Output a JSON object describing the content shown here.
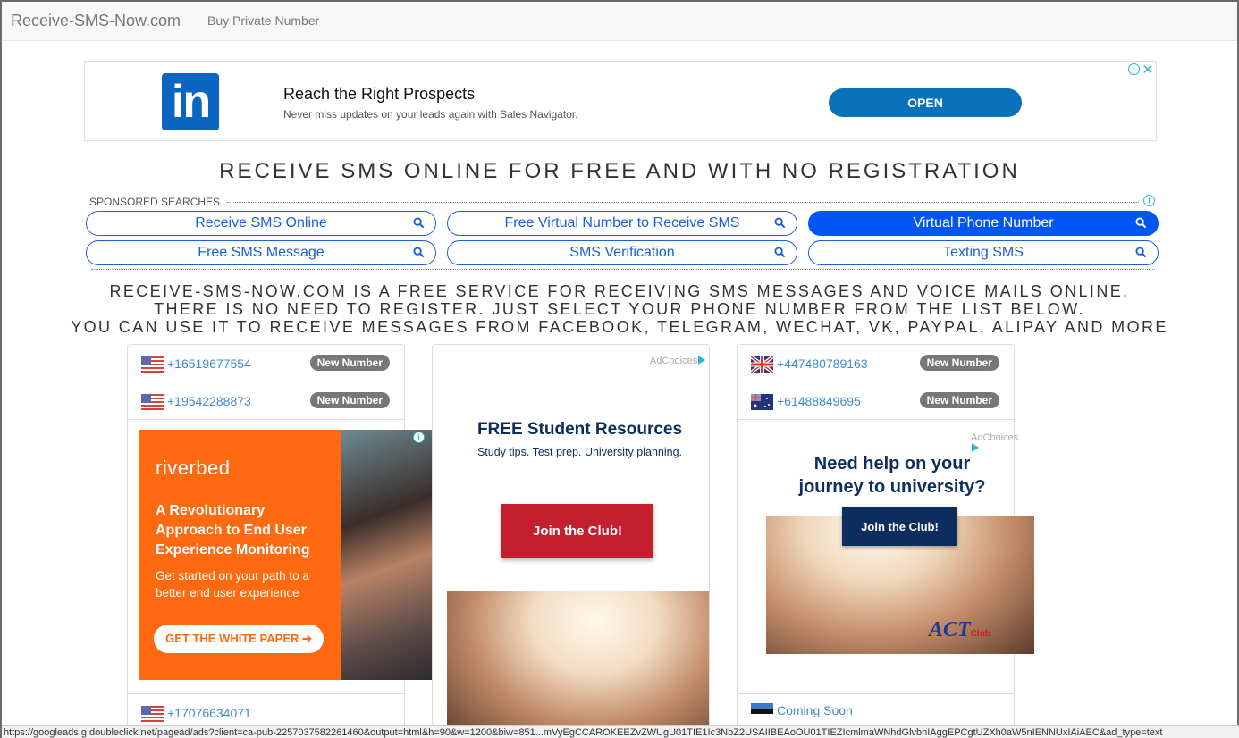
{
  "navbar": {
    "brand": "Receive-SMS-Now.com",
    "links": [
      "Buy Private Number"
    ]
  },
  "top_ad": {
    "logo_text": "in",
    "headline": "Reach the Right Prospects",
    "subtext": "Never miss updates on your leads again with Sales Navigator.",
    "cta": "OPEN",
    "info_icon": "i",
    "close_icon": "✕"
  },
  "page_title": "RECEIVE SMS ONLINE FOR FREE AND WITH NO REGISTRATION",
  "sponsored": {
    "label": "SPONSORED SEARCHES",
    "info_icon": "i",
    "buttons": [
      {
        "label": "Receive SMS Online",
        "active": false
      },
      {
        "label": "Free Virtual Number to Receive SMS",
        "active": false
      },
      {
        "label": "Virtual Phone Number",
        "active": true
      },
      {
        "label": "Free SMS Message",
        "active": false
      },
      {
        "label": "SMS Verification",
        "active": false
      },
      {
        "label": "Texting SMS",
        "active": false
      }
    ]
  },
  "description": {
    "line1": "RECEIVE-SMS-NOW.COM IS A FREE SERVICE FOR RECEIVING SMS MESSAGES AND VOICE MAILS ONLINE.",
    "line2": "THERE IS NO NEED TO REGISTER. JUST SELECT YOUR PHONE NUMBER FROM THE LIST BELOW.",
    "line3": "YOU CAN USE IT TO RECEIVE MESSAGES FROM FACEBOOK, TELEGRAM, WECHAT, VK, PAYPAL, ALIPAY AND MORE"
  },
  "numbers": {
    "left": [
      {
        "country": "us",
        "number": "+16519677554",
        "badge": "New Number"
      },
      {
        "country": "us",
        "number": "+19542288873",
        "badge": "New Number"
      },
      {
        "country": "us",
        "number": "+17076634071",
        "badge": ""
      }
    ],
    "right": [
      {
        "country": "gb",
        "number": "+447480789163",
        "badge": "New Number"
      },
      {
        "country": "au",
        "number": "+61488849695",
        "badge": "New Number"
      },
      {
        "country": "ee",
        "number": "Coming Soon",
        "badge": ""
      }
    ]
  },
  "riverbed_ad": {
    "logo": "riverbed",
    "headline": "A Revolutionary Approach to End User Experience Monitoring",
    "subtext": "Get started on your path to a better end user experience",
    "cta": "GET THE WHITE PAPER ➔"
  },
  "act_ad_1": {
    "adchoices": "AdChoices",
    "headline": "FREE Student Resources",
    "subtext": "Study tips. Test prep. University planning.",
    "cta": "Join the Club!"
  },
  "act_ad_2": {
    "adchoices": "AdChoices",
    "headline_line1": "Need help on your",
    "headline_line2": "journey to university?",
    "cta": "Join the Club!",
    "logo": "ACT",
    "logo_sub": "Club"
  },
  "status_bar": {
    "url": "https://googleads.g.doubleclick.net/pagead/ads?client=ca-pub-2257037582261460&output=html&h=90&w=1200&biw=851...mVyEgCCAROKEEZvZWUgU01TIE1Ic3NbZ2USAIIBEAoOU01TIEZIcmlmaWNhdGlvbhIAggEPCgtUZXh0aW5nIENNUxIAiAEC&ad_type=text"
  },
  "colors": {
    "link": "#428bca",
    "badge": "#777777",
    "sponsored_blue": "#1a5fe0",
    "active_blue": "#0055f5",
    "linkedin_blue": "#0a72b8",
    "riverbed_orange": "#ff6a10",
    "act_navy": "#0d2d5e",
    "act_red": "#c41f2f"
  }
}
